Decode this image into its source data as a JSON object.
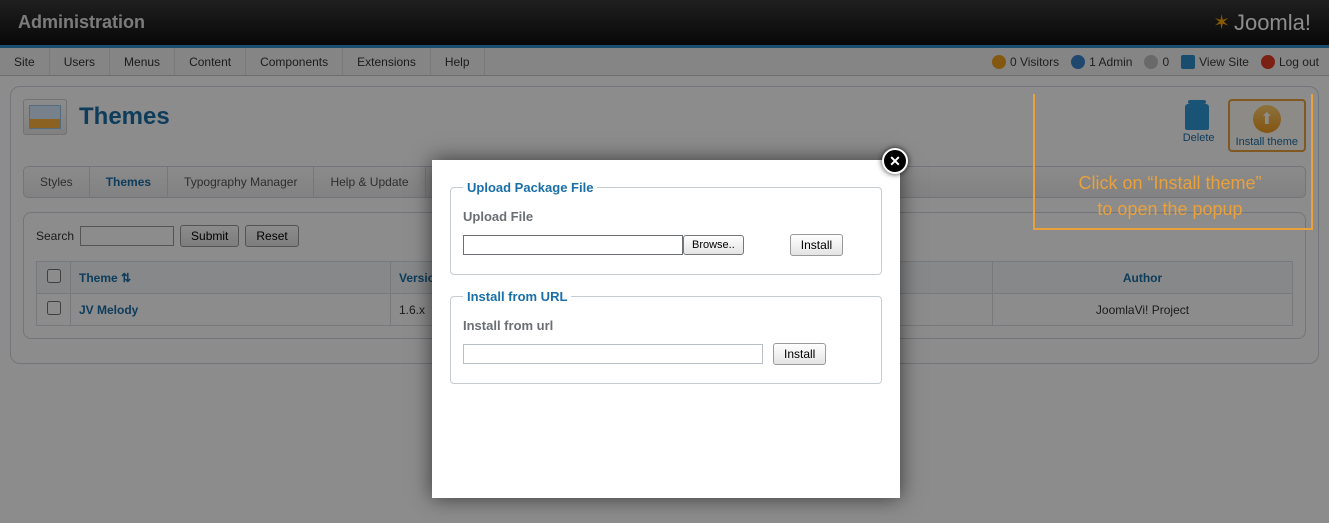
{
  "header": {
    "title": "Administration",
    "brand": "Joomla!"
  },
  "menu": [
    "Site",
    "Users",
    "Menus",
    "Content",
    "Components",
    "Extensions",
    "Help"
  ],
  "status": {
    "visitors": "0 Visitors",
    "admin": "1 Admin",
    "messages": "0",
    "view": "View Site",
    "logout": "Log out"
  },
  "page": {
    "title": "Themes"
  },
  "toolbar": {
    "delete": "Delete",
    "install": "Install theme"
  },
  "tabs": [
    "Styles",
    "Themes",
    "Typography Manager",
    "Help & Update"
  ],
  "active_tab": "Themes",
  "search": {
    "label": "Search",
    "submit": "Submit",
    "reset": "Reset",
    "value": ""
  },
  "table": {
    "cols": [
      "",
      "Theme ⇅",
      "Version",
      "",
      "Author"
    ],
    "rows": [
      {
        "theme": "JV Melody",
        "version": "1.6.x",
        "mid": "",
        "author": "JoomlaVi! Project"
      }
    ]
  },
  "modal": {
    "upload_legend": "Upload Package File",
    "upload_label": "Upload File",
    "browse": "Browse..",
    "install_btn": "Install",
    "url_legend": "Install from URL",
    "url_label": "Install from url",
    "url_value": ""
  },
  "annotation": "Click on “Install theme”\nto open the popup"
}
